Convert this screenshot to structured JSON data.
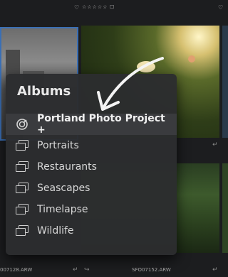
{
  "popup": {
    "title": "Albums",
    "items": [
      {
        "label": "Portland Photo Project +",
        "icon": "project-icon",
        "selected": true
      },
      {
        "label": "Portraits",
        "icon": "album-icon"
      },
      {
        "label": "Restaurants",
        "icon": "album-icon"
      },
      {
        "label": "Seascapes",
        "icon": "album-icon"
      },
      {
        "label": "Timelapse",
        "icon": "album-icon"
      },
      {
        "label": "Wildlife",
        "icon": "album-icon"
      }
    ]
  },
  "grid": {
    "top_rating_stars": "☆☆☆☆☆",
    "filenames": [
      "007128.ARW",
      "SFO07152.ARW"
    ]
  },
  "colors": {
    "background": "#1c1d1f",
    "popup_bg": "#2c2d2f",
    "selected_row": "#3a3b3e",
    "selected_tile_border": "#3a6fb5"
  }
}
